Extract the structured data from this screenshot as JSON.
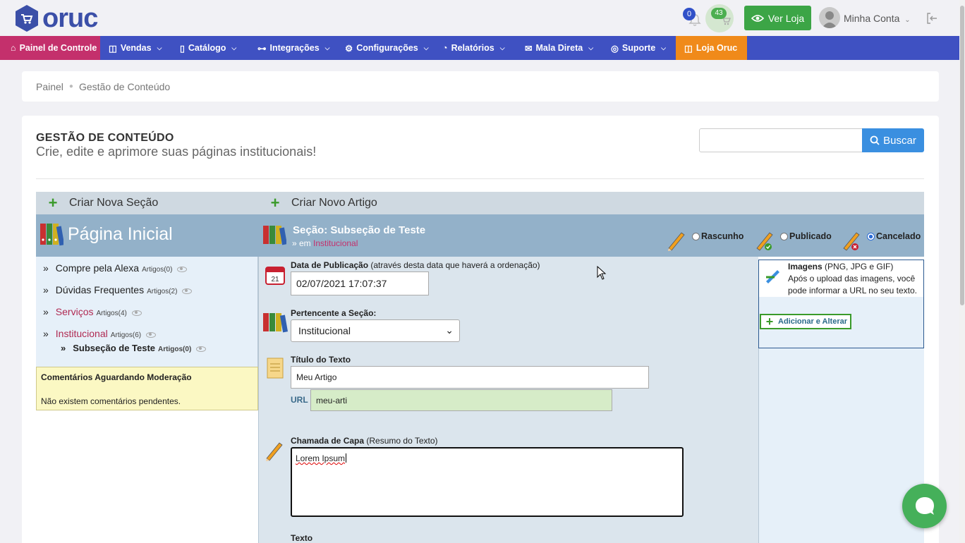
{
  "brand": {
    "logo_text": "oruc"
  },
  "header": {
    "notifications_count": "0",
    "cart_count": "43",
    "ver_loja_label": "Ver Loja",
    "account_label": "Minha Conta"
  },
  "nav": {
    "items": [
      {
        "label": "Painel de Controle"
      },
      {
        "label": "Vendas"
      },
      {
        "label": "Catálogo"
      },
      {
        "label": "Integrações"
      },
      {
        "label": "Configurações"
      },
      {
        "label": "Relatórios"
      },
      {
        "label": "Mala Direta"
      },
      {
        "label": "Suporte"
      },
      {
        "label": "Loja Oruc"
      }
    ]
  },
  "breadcrumb": {
    "items": [
      "Painel",
      "Gestão de Conteúdo"
    ]
  },
  "page": {
    "title": "GESTÃO DE CONTEÚDO",
    "subtitle": "Crie, edite e aprimore suas páginas institucionais!",
    "search_placeholder": "",
    "search_button": "Buscar"
  },
  "actions": {
    "new_section": "Criar Nova Seção",
    "new_article": "Criar Novo Artigo"
  },
  "left": {
    "home_title": "Página Inicial",
    "items": [
      {
        "name": "Compre pela Alexa",
        "count": "Artigos(0)"
      },
      {
        "name": "Dúvidas Frequentes",
        "count": "Artigos(2)"
      },
      {
        "name": "Serviços",
        "count": "Artigos(4)"
      },
      {
        "name": "Institucional",
        "count": "Artigos(6)"
      },
      {
        "name": "Subseção de Teste",
        "count": "Artigos(0)"
      }
    ],
    "comments_title": "Comentários Aguardando Moderação",
    "comments_message": "Não existem comentários pendentes."
  },
  "section": {
    "title": "Seção: Subseção de Teste",
    "parent_prefix": "» em",
    "parent": "Institucional",
    "status_options": [
      "Rascunho",
      "Publicado",
      "Cancelado"
    ],
    "status_selected": "Cancelado"
  },
  "form": {
    "pub_date_label": "Data de Publicação",
    "pub_date_hint": "(através desta data que haverá a ordenação)",
    "pub_date_value": "02/07/2021 17:07:37",
    "section_label": "Pertencente a Seção:",
    "section_value": "Institucional",
    "title_label": "Título do Texto",
    "title_value": "Meu Artigo",
    "url_label": "URL",
    "url_value": "meu-arti",
    "summary_label": "Chamada de Capa",
    "summary_hint": "(Resumo do Texto)",
    "summary_value": "Lorem Ipsum",
    "text_label": "Texto"
  },
  "images": {
    "title": "Imagens",
    "formats": "(PNG, JPG e GIF)",
    "description": "Após o upload das imagens, você pode informar a URL no seu texto.",
    "button": "Adicionar e Alterar"
  },
  "colors": {
    "nav_bg": "#3f51c2",
    "home_tab": "#c4306c",
    "loja_tab": "#f08a1a",
    "ver_loja": "#3ca546",
    "buscar": "#3a8fe0"
  }
}
